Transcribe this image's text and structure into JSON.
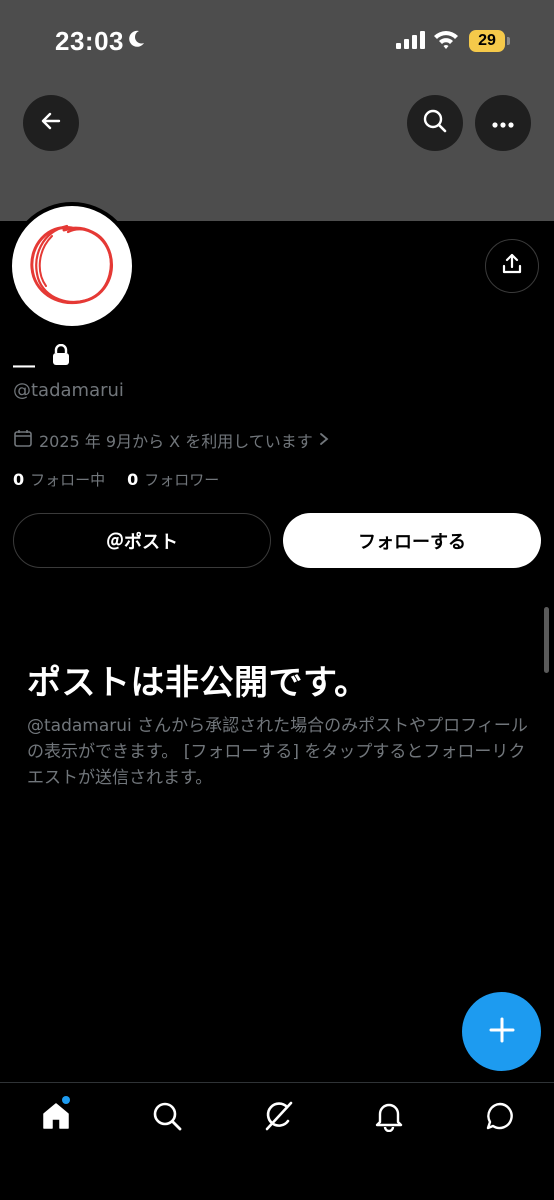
{
  "status_bar": {
    "time": "23:03",
    "battery": "29"
  },
  "profile": {
    "display_name": "__",
    "handle": "@tadamarui",
    "joined": "2025 年 9月から X を利用しています",
    "following_count": "0",
    "following_label": "フォロー中",
    "followers_count": "0",
    "followers_label": "フォロワー"
  },
  "actions": {
    "post_label": "＠ポスト",
    "follow_label": "フォローする"
  },
  "private_notice": {
    "title": "ポストは非公開です。",
    "body": "@tadamarui さんから承認された場合のみポストやプロフィールの表示ができます。 [フォローする] をタップするとフォローリクエストが送信されます。"
  },
  "colors": {
    "accent": "#1d9bf0",
    "banner": "#4d4d4d",
    "battery": "#f5c94a",
    "avatar_scribble": "#e53935"
  },
  "icons": {
    "back": "arrow-left-icon",
    "search": "search-icon",
    "more": "more-horizontal-icon",
    "share": "share-icon",
    "lock": "lock-icon",
    "calendar": "calendar-icon",
    "compose": "plus-icon"
  },
  "tabs": [
    {
      "name": "home",
      "icon": "home-icon"
    },
    {
      "name": "explore",
      "icon": "search-icon"
    },
    {
      "name": "grok",
      "icon": "grok-icon"
    },
    {
      "name": "notifications",
      "icon": "bell-icon"
    },
    {
      "name": "messages",
      "icon": "message-icon"
    }
  ]
}
